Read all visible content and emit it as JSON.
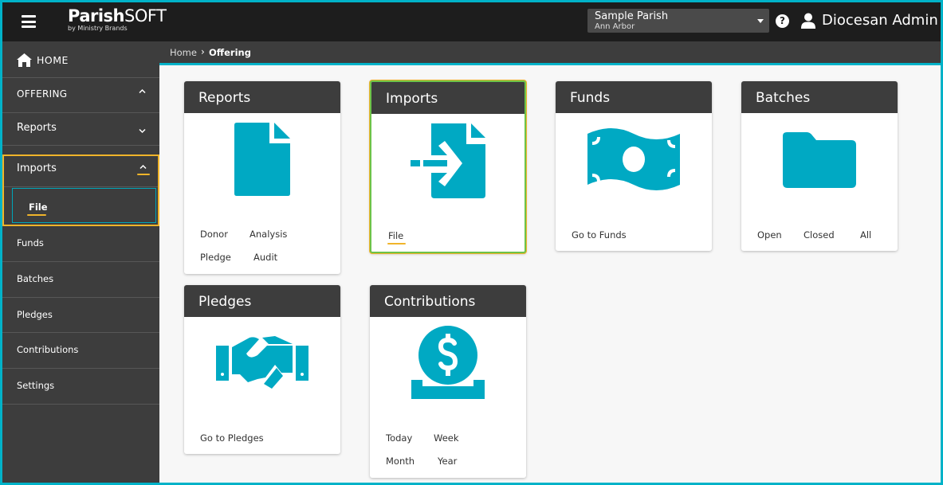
{
  "app": {
    "logo_main": "Parish",
    "logo_light": "SOFT",
    "logo_sub": "by Ministry Brands"
  },
  "topbar": {
    "parish_name": "Sample Parish",
    "parish_city": "Ann Arbor",
    "help_label": "?",
    "user_name": "Diocesan Admin"
  },
  "sidebar": {
    "home": "HOME",
    "offering": "OFFERING",
    "reports": "Reports",
    "imports": "Imports",
    "file": "File",
    "funds": "Funds",
    "batches": "Batches",
    "pledges": "Pledges",
    "contributions": "Contributions",
    "settings": "Settings"
  },
  "breadcrumb": {
    "home": "Home",
    "separator": "›",
    "current": "Offering"
  },
  "cards": {
    "reports": {
      "title": "Reports",
      "links": [
        "Donor",
        "Analysis",
        "Pledge",
        "Audit"
      ]
    },
    "imports": {
      "title": "Imports",
      "links": [
        "File"
      ]
    },
    "funds": {
      "title": "Funds",
      "links": [
        "Go to Funds"
      ]
    },
    "batches": {
      "title": "Batches",
      "links": [
        "Open",
        "Closed",
        "All"
      ]
    },
    "pledges": {
      "title": "Pledges",
      "links": [
        "Go to Pledges"
      ]
    },
    "contributions": {
      "title": "Contributions",
      "links": [
        "Today",
        "Week",
        "Month",
        "Year"
      ]
    }
  },
  "colors": {
    "accent": "#00b2c8",
    "icon": "#00a9c3",
    "highlight": "#f0b42a",
    "active_border": "#6dc34a",
    "dark": "#1d1d1d",
    "sidebar": "#3d3d3d"
  },
  "icons": [
    "menu-icon",
    "help-icon",
    "user-icon",
    "home-icon",
    "chevron-up-icon",
    "chevron-down-icon",
    "document-icon",
    "import-file-icon",
    "money-bill-icon",
    "folder-icon",
    "handshake-icon",
    "dollar-coin-icon",
    "dropdown-caret-icon"
  ]
}
